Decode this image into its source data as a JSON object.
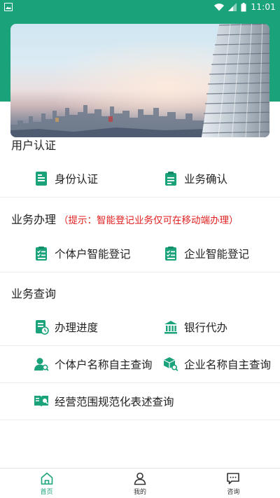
{
  "status_bar": {
    "time": "11:01"
  },
  "colors": {
    "accent": "#1aa37a",
    "hint_red": "#e02020"
  },
  "sections": {
    "auth": {
      "title": "用户认证",
      "items": [
        {
          "label": "身份认证",
          "icon": "id-card-icon"
        },
        {
          "label": "业务确认",
          "icon": "clipboard-check-icon"
        }
      ]
    },
    "business": {
      "title": "业务办理",
      "hint": "（提示：智能登记业务仅可在移动端办理）",
      "items": [
        {
          "label": "个体户智能登记",
          "icon": "checklist-icon"
        },
        {
          "label": "企业智能登记",
          "icon": "checklist-icon"
        }
      ]
    },
    "query": {
      "title": "业务查询",
      "items": [
        {
          "label": "办理进度",
          "icon": "progress-doc-icon"
        },
        {
          "label": "银行代办",
          "icon": "bank-icon"
        },
        {
          "label": "个体户名称自主查询",
          "icon": "user-search-icon"
        },
        {
          "label": "企业名称自主查询",
          "icon": "box-search-icon"
        },
        {
          "label": "经营范围规范化表述查询",
          "icon": "book-search-icon"
        }
      ]
    }
  },
  "bottom_nav": [
    {
      "label": "首页",
      "icon": "home-icon",
      "active": true
    },
    {
      "label": "我的",
      "icon": "user-icon",
      "active": false
    },
    {
      "label": "咨询",
      "icon": "chat-icon",
      "active": false
    }
  ]
}
